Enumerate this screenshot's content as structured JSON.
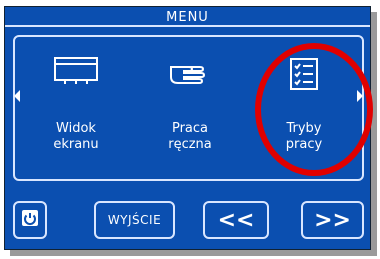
{
  "header": {
    "title": "MENU"
  },
  "tiles": [
    {
      "label_line1": "Widok",
      "label_line2": "ekranu",
      "icon": "screen-view-icon"
    },
    {
      "label_line1": "Praca",
      "label_line2": "ręczna",
      "icon": "hand-icon"
    },
    {
      "label_line1": "Tryby",
      "label_line2": "pracy",
      "icon": "checklist-icon"
    }
  ],
  "bottom": {
    "power_icon": "power-icon",
    "exit_label": "WYJŚCIE",
    "prev_label": "<<",
    "next_label": ">>"
  },
  "colors": {
    "panel": "#0b4fb0",
    "outline": "#d9e6ff",
    "highlight": "#e00000"
  }
}
